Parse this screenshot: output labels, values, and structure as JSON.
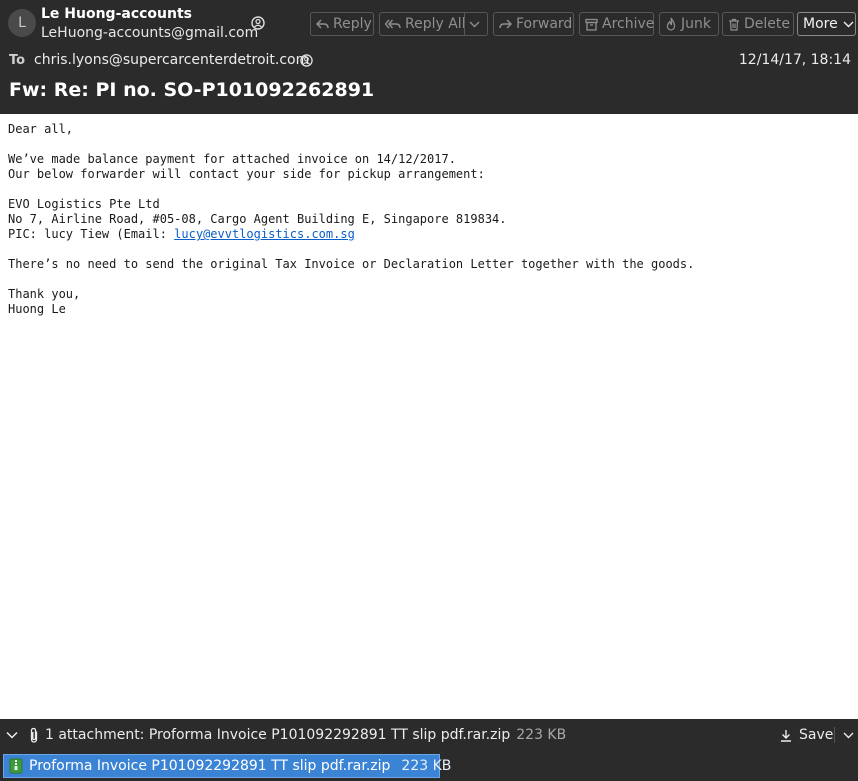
{
  "header": {
    "avatar_letter": "L",
    "from_name": "Le Huong-accounts",
    "from_email": "LeHuong-accounts@gmail.com",
    "to_label": "To",
    "to_value": "chris.lyons@supercarcenterdetroit.com",
    "date": "12/14/17, 18:14",
    "subject": "Fw: Re: PI no. SO-P101092262891"
  },
  "toolbar": {
    "reply": "Reply",
    "reply_all": "Reply All",
    "forward": "Forward",
    "archive": "Archive",
    "junk": "Junk",
    "delete": "Delete",
    "more": "More"
  },
  "body": {
    "greeting": "Dear all,",
    "line1": "We’ve made balance payment for attached invoice on 14/12/2017.",
    "line2": "Our below forwarder will contact your side for pickup arrangement:",
    "company": "EVO Logistics Pte Ltd",
    "address": "No 7, Airline Road, #05-08, Cargo Agent Building E, Singapore 819834.",
    "pic_prefix": "PIC: lucy Tiew (Email: ",
    "pic_email": "lucy@evvtlogistics.com.sg",
    "note": "There’s no need to send the original Tax Invoice or Declaration Letter together with the goods.",
    "thanks": "Thank you,",
    "signature": "Huong Le"
  },
  "attachments": {
    "summary": "1 attachment: Proforma Invoice P101092292891 TT slip pdf.rar.zip",
    "summary_size": "223 KB",
    "save_label": "Save",
    "items": [
      {
        "name": "Proforma Invoice P101092292891 TT slip pdf.rar.zip",
        "size": "223 KB"
      }
    ]
  },
  "colors": {
    "header_bg": "#2b2b2b",
    "link": "#0a5fc9",
    "attachment_selected": "#3b83d4"
  }
}
